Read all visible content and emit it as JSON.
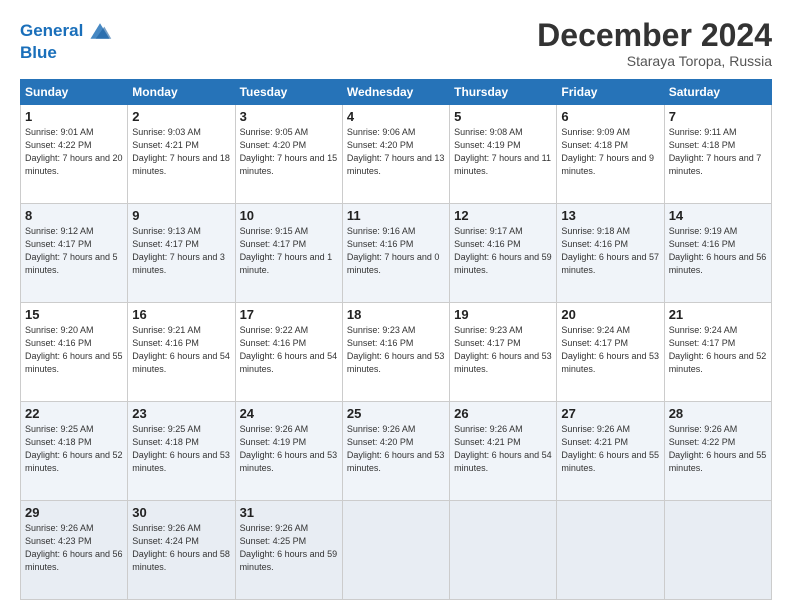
{
  "logo": {
    "line1": "General",
    "line2": "Blue"
  },
  "title": "December 2024",
  "subtitle": "Staraya Toropa, Russia",
  "weekdays": [
    "Sunday",
    "Monday",
    "Tuesday",
    "Wednesday",
    "Thursday",
    "Friday",
    "Saturday"
  ],
  "weeks": [
    [
      {
        "day": "1",
        "rise": "Sunrise: 9:01 AM",
        "set": "Sunset: 4:22 PM",
        "daylight": "Daylight: 7 hours and 20 minutes."
      },
      {
        "day": "2",
        "rise": "Sunrise: 9:03 AM",
        "set": "Sunset: 4:21 PM",
        "daylight": "Daylight: 7 hours and 18 minutes."
      },
      {
        "day": "3",
        "rise": "Sunrise: 9:05 AM",
        "set": "Sunset: 4:20 PM",
        "daylight": "Daylight: 7 hours and 15 minutes."
      },
      {
        "day": "4",
        "rise": "Sunrise: 9:06 AM",
        "set": "Sunset: 4:20 PM",
        "daylight": "Daylight: 7 hours and 13 minutes."
      },
      {
        "day": "5",
        "rise": "Sunrise: 9:08 AM",
        "set": "Sunset: 4:19 PM",
        "daylight": "Daylight: 7 hours and 11 minutes."
      },
      {
        "day": "6",
        "rise": "Sunrise: 9:09 AM",
        "set": "Sunset: 4:18 PM",
        "daylight": "Daylight: 7 hours and 9 minutes."
      },
      {
        "day": "7",
        "rise": "Sunrise: 9:11 AM",
        "set": "Sunset: 4:18 PM",
        "daylight": "Daylight: 7 hours and 7 minutes."
      }
    ],
    [
      {
        "day": "8",
        "rise": "Sunrise: 9:12 AM",
        "set": "Sunset: 4:17 PM",
        "daylight": "Daylight: 7 hours and 5 minutes."
      },
      {
        "day": "9",
        "rise": "Sunrise: 9:13 AM",
        "set": "Sunset: 4:17 PM",
        "daylight": "Daylight: 7 hours and 3 minutes."
      },
      {
        "day": "10",
        "rise": "Sunrise: 9:15 AM",
        "set": "Sunset: 4:17 PM",
        "daylight": "Daylight: 7 hours and 1 minute."
      },
      {
        "day": "11",
        "rise": "Sunrise: 9:16 AM",
        "set": "Sunset: 4:16 PM",
        "daylight": "Daylight: 7 hours and 0 minutes."
      },
      {
        "day": "12",
        "rise": "Sunrise: 9:17 AM",
        "set": "Sunset: 4:16 PM",
        "daylight": "Daylight: 6 hours and 59 minutes."
      },
      {
        "day": "13",
        "rise": "Sunrise: 9:18 AM",
        "set": "Sunset: 4:16 PM",
        "daylight": "Daylight: 6 hours and 57 minutes."
      },
      {
        "day": "14",
        "rise": "Sunrise: 9:19 AM",
        "set": "Sunset: 4:16 PM",
        "daylight": "Daylight: 6 hours and 56 minutes."
      }
    ],
    [
      {
        "day": "15",
        "rise": "Sunrise: 9:20 AM",
        "set": "Sunset: 4:16 PM",
        "daylight": "Daylight: 6 hours and 55 minutes."
      },
      {
        "day": "16",
        "rise": "Sunrise: 9:21 AM",
        "set": "Sunset: 4:16 PM",
        "daylight": "Daylight: 6 hours and 54 minutes."
      },
      {
        "day": "17",
        "rise": "Sunrise: 9:22 AM",
        "set": "Sunset: 4:16 PM",
        "daylight": "Daylight: 6 hours and 54 minutes."
      },
      {
        "day": "18",
        "rise": "Sunrise: 9:23 AM",
        "set": "Sunset: 4:16 PM",
        "daylight": "Daylight: 6 hours and 53 minutes."
      },
      {
        "day": "19",
        "rise": "Sunrise: 9:23 AM",
        "set": "Sunset: 4:17 PM",
        "daylight": "Daylight: 6 hours and 53 minutes."
      },
      {
        "day": "20",
        "rise": "Sunrise: 9:24 AM",
        "set": "Sunset: 4:17 PM",
        "daylight": "Daylight: 6 hours and 53 minutes."
      },
      {
        "day": "21",
        "rise": "Sunrise: 9:24 AM",
        "set": "Sunset: 4:17 PM",
        "daylight": "Daylight: 6 hours and 52 minutes."
      }
    ],
    [
      {
        "day": "22",
        "rise": "Sunrise: 9:25 AM",
        "set": "Sunset: 4:18 PM",
        "daylight": "Daylight: 6 hours and 52 minutes."
      },
      {
        "day": "23",
        "rise": "Sunrise: 9:25 AM",
        "set": "Sunset: 4:18 PM",
        "daylight": "Daylight: 6 hours and 53 minutes."
      },
      {
        "day": "24",
        "rise": "Sunrise: 9:26 AM",
        "set": "Sunset: 4:19 PM",
        "daylight": "Daylight: 6 hours and 53 minutes."
      },
      {
        "day": "25",
        "rise": "Sunrise: 9:26 AM",
        "set": "Sunset: 4:20 PM",
        "daylight": "Daylight: 6 hours and 53 minutes."
      },
      {
        "day": "26",
        "rise": "Sunrise: 9:26 AM",
        "set": "Sunset: 4:21 PM",
        "daylight": "Daylight: 6 hours and 54 minutes."
      },
      {
        "day": "27",
        "rise": "Sunrise: 9:26 AM",
        "set": "Sunset: 4:21 PM",
        "daylight": "Daylight: 6 hours and 55 minutes."
      },
      {
        "day": "28",
        "rise": "Sunrise: 9:26 AM",
        "set": "Sunset: 4:22 PM",
        "daylight": "Daylight: 6 hours and 55 minutes."
      }
    ],
    [
      {
        "day": "29",
        "rise": "Sunrise: 9:26 AM",
        "set": "Sunset: 4:23 PM",
        "daylight": "Daylight: 6 hours and 56 minutes."
      },
      {
        "day": "30",
        "rise": "Sunrise: 9:26 AM",
        "set": "Sunset: 4:24 PM",
        "daylight": "Daylight: 6 hours and 58 minutes."
      },
      {
        "day": "31",
        "rise": "Sunrise: 9:26 AM",
        "set": "Sunset: 4:25 PM",
        "daylight": "Daylight: 6 hours and 59 minutes."
      },
      null,
      null,
      null,
      null
    ]
  ]
}
